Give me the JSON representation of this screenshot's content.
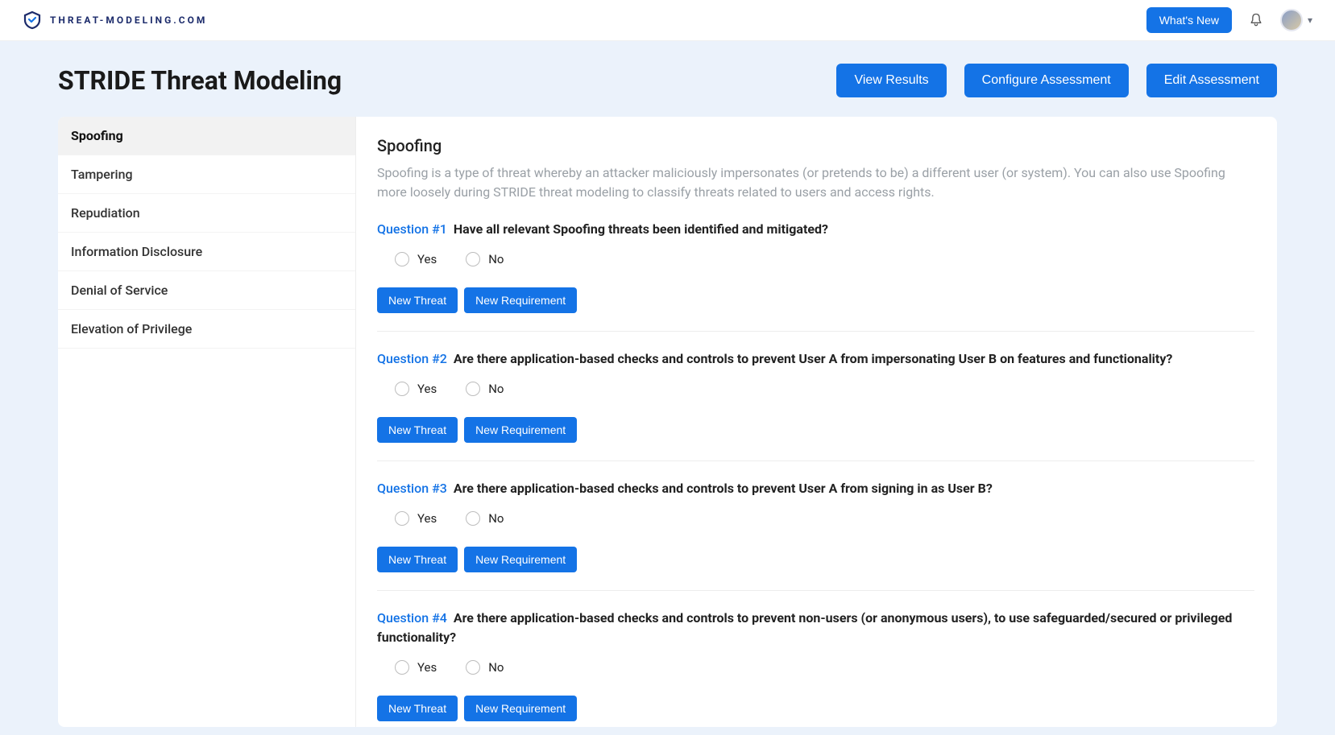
{
  "brand": {
    "text": "THREAT-MODELING.COM"
  },
  "topbar": {
    "whats_new": "What's New"
  },
  "header": {
    "title": "STRIDE Threat Modeling",
    "view_results": "View Results",
    "configure_assessment": "Configure Assessment",
    "edit_assessment": "Edit Assessment"
  },
  "sidebar": {
    "items": [
      {
        "label": "Spoofing",
        "active": true
      },
      {
        "label": "Tampering",
        "active": false
      },
      {
        "label": "Repudiation",
        "active": false
      },
      {
        "label": "Information Disclosure",
        "active": false
      },
      {
        "label": "Denial of Service",
        "active": false
      },
      {
        "label": "Elevation of Privilege",
        "active": false
      }
    ]
  },
  "section": {
    "title": "Spoofing",
    "description": "Spoofing is a type of threat whereby an attacker maliciously impersonates (or pretends to be) a different user (or system). You can also use Spoofing more loosely during STRIDE threat modeling to classify threats related to users and access rights."
  },
  "radio": {
    "yes": "Yes",
    "no": "No"
  },
  "buttons": {
    "new_threat": "New Threat",
    "new_requirement": "New Requirement"
  },
  "questions": [
    {
      "tag": "Question #1",
      "text": "Have all relevant Spoofing threats been identified and mitigated?"
    },
    {
      "tag": "Question #2",
      "text": "Are there application-based checks and controls to prevent User A from impersonating User B on features and functionality?"
    },
    {
      "tag": "Question #3",
      "text": "Are there application-based checks and controls to prevent User A from signing in as User B?"
    },
    {
      "tag": "Question #4",
      "text": "Are there application-based checks and controls to prevent non-users (or anonymous users), to use safeguarded/secured or privileged functionality?"
    }
  ]
}
